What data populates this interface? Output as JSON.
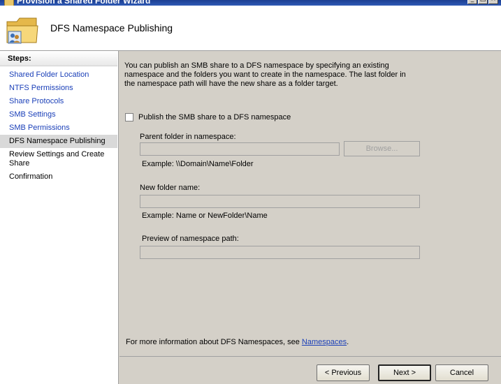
{
  "window": {
    "title": "Provision a Shared Folder Wizard",
    "minimize_glyph": "_",
    "maximize_glyph": "□",
    "close_glyph": "×"
  },
  "header": {
    "title": "DFS Namespace Publishing",
    "icon": "shared-folder-users-icon"
  },
  "sidebar": {
    "title": "Steps:",
    "items": [
      {
        "label": "Shared Folder Location"
      },
      {
        "label": "NTFS Permissions"
      },
      {
        "label": "Share Protocols"
      },
      {
        "label": "SMB Settings"
      },
      {
        "label": "SMB Permissions"
      },
      {
        "label": "DFS Namespace Publishing"
      },
      {
        "label": "Review Settings and Create Share"
      },
      {
        "label": "Confirmation"
      }
    ]
  },
  "main": {
    "description": "You can publish an SMB share to a DFS namespace by specifying an existing namespace and the folders you want to create in the namespace. The last folder in the namespace path will have the new share as a folder target.",
    "publish_checkbox_label": "Publish the SMB share to a DFS namespace",
    "publish_checked": false,
    "parent_folder_label": "Parent folder in namespace:",
    "parent_folder_value": "",
    "browse_label": "Browse...",
    "parent_example": "Example: \\\\Domain\\Name\\Folder",
    "new_folder_label": "New folder name:",
    "new_folder_value": "",
    "new_folder_example": "Example: Name or NewFolder\\Name",
    "preview_label": "Preview of namespace path:",
    "preview_value": "",
    "more_info_prefix": "For more information about DFS Namespaces, see ",
    "more_info_link": "Namespaces",
    "more_info_suffix": "."
  },
  "buttons": {
    "previous": "< Previous",
    "next": "Next >",
    "cancel": "Cancel"
  }
}
